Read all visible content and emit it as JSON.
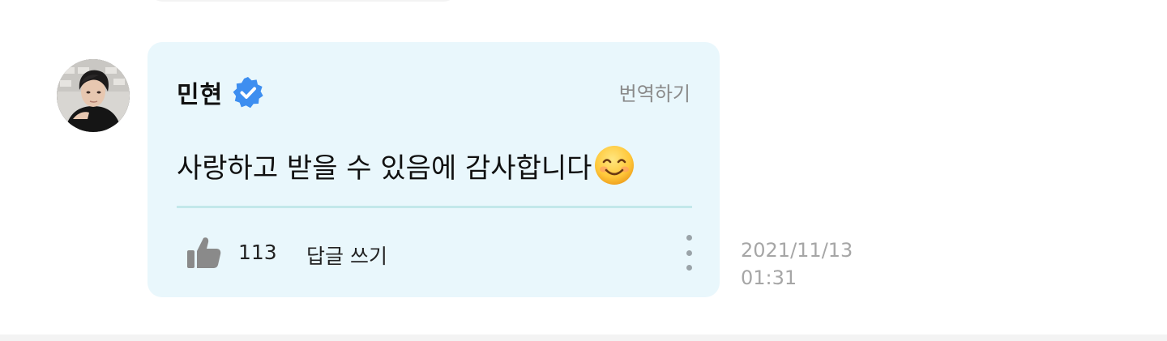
{
  "comment": {
    "author": {
      "name": "민현",
      "verified": true,
      "avatar_icon": "profile-photo",
      "verified_icon": "verified-badge-icon",
      "badge_color": "#3d8ef0"
    },
    "translate_label": "번역하기",
    "message": "사랑하고 받을 수 있음에 감사합니다",
    "message_emoji": "smiling-face-emoji",
    "likes": {
      "icon": "thumbs-up-icon",
      "count": "113"
    },
    "reply_label": "답글 쓰기",
    "more_icon": "more-vertical-icon",
    "timestamp": {
      "date": "2021/11/13",
      "time": "01:31"
    }
  },
  "colors": {
    "card_background": "#e9f7fc",
    "divider": "#c3e8ea",
    "muted_text": "#8a8a8a",
    "timestamp_text": "#a6a6a6"
  }
}
